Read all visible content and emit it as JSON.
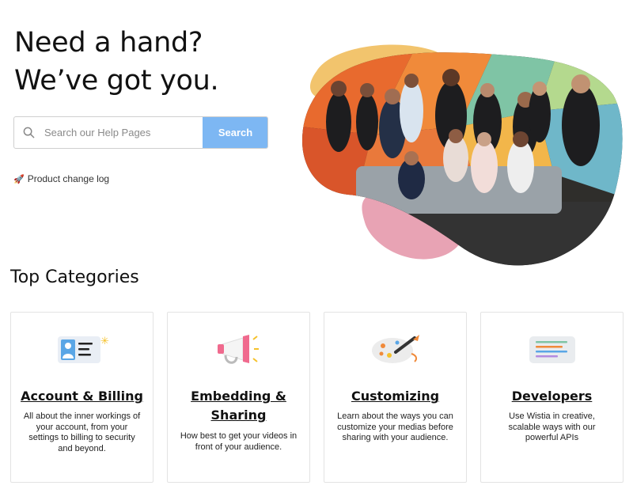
{
  "hero": {
    "title_line1": "Need a hand?",
    "title_line2": "We’ve got you."
  },
  "search": {
    "placeholder": "Search our Help Pages",
    "button_label": "Search",
    "icon": "search-icon"
  },
  "changelog": {
    "icon": "rocket-icon",
    "label": "Product change log"
  },
  "section_title": "Top Categories",
  "categories": [
    {
      "title": "Account & Billing",
      "icon": "id-card-icon",
      "description": "All about the inner workings of your account, from your settings to billing to security and beyond."
    },
    {
      "title": "Embedding & Sharing",
      "icon": "megaphone-icon",
      "description": "How best to get your videos in front of your audience."
    },
    {
      "title": "Customizing",
      "icon": "paint-palette-icon",
      "description": "Learn about the ways you can customize your medias before sharing with your audience."
    },
    {
      "title": "Developers",
      "icon": "code-window-icon",
      "description": "Use Wistia in creative, scalable ways with our powerful APIs"
    }
  ],
  "colors": {
    "accent_blue": "#7db7f3",
    "blob_yellow": "#f2c46d",
    "blob_pink": "#e8a3b4"
  }
}
